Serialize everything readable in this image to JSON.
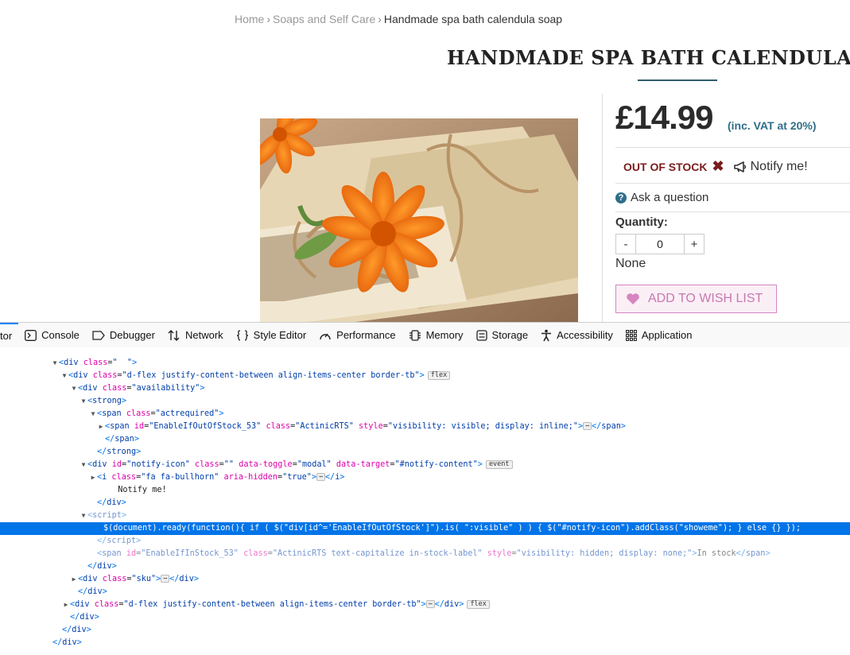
{
  "breadcrumb": {
    "home": "Home",
    "category": "Soaps and Self Care",
    "current": "Handmade spa bath calendula soap"
  },
  "product": {
    "title": "HANDMADE SPA BATH CALENDULA SOAP",
    "image_alt": "Calendula soap bars",
    "price": "£14.99",
    "vat_note": "(inc. VAT at 20%)",
    "stock_status": "OUT OF STOCK",
    "stock_mark": "✖",
    "notify_label": "Notify me!",
    "ask_label": "Ask a question",
    "quantity_label": "Quantity:",
    "quantity_minus": "-",
    "quantity_value": "0",
    "quantity_plus": "+",
    "none_text": "None",
    "wishlist_label": "ADD TO WISH LIST"
  },
  "devtools": {
    "tabs": [
      {
        "label": "tor",
        "icon": "inspector-icon"
      },
      {
        "label": "Console",
        "icon": "console-icon"
      },
      {
        "label": "Debugger",
        "icon": "debugger-icon"
      },
      {
        "label": "Network",
        "icon": "network-icon"
      },
      {
        "label": "Style Editor",
        "icon": "style-editor-icon"
      },
      {
        "label": "Performance",
        "icon": "performance-icon"
      },
      {
        "label": "Memory",
        "icon": "memory-icon"
      },
      {
        "label": "Storage",
        "icon": "storage-icon"
      },
      {
        "label": "Accessibility",
        "icon": "accessibility-icon"
      },
      {
        "label": "Application",
        "icon": "application-icon"
      }
    ],
    "lines": [
      {
        "t": "▼",
        "html": "<span class=tag>&lt;</span><span class=tagn>div</span> <span class=an>class</span>=<span class=av>\"  \"</span><span class=tag>&gt;</span>"
      },
      {
        "t": "▼",
        "html": "<span class=tag>&lt;</span><span class=tagn>div</span> <span class=an>class</span>=<span class=av>\"d-flex justify-content-between align-items-center border-tb\"</span><span class=tag>&gt;</span><span class=badge>flex</span>"
      },
      {
        "t": "▼",
        "html": "<span class=tag>&lt;</span><span class=tagn>div</span> <span class=an>class</span>=<span class=av>\"availability\"</span><span class=tag>&gt;</span>"
      },
      {
        "t": "▼",
        "html": "<span class=tag>&lt;</span><span class=tagn>strong</span><span class=tag>&gt;</span>"
      },
      {
        "t": "▼",
        "html": "<span class=tag>&lt;</span><span class=tagn>span</span> <span class=an>class</span>=<span class=av>\"actrequired\"</span><span class=tag>&gt;</span>"
      },
      {
        "t": "▶",
        "html": "<span class=tag>&lt;</span><span class=tagn>span</span> <span class=an>id</span>=<span class=av>\"EnableIfOutOfStock_53\"</span> <span class=an>class</span>=<span class=av>\"ActinicRTS\"</span> <span class=an>style</span>=<span class=av>\"visibility: visible; display: inline;\"</span><span class=tag>&gt;</span><span class=ell>⋯</span><span class=tag>&lt;/</span><span class=tagn>span</span><span class=tag>&gt;</span>"
      },
      {
        "t": "",
        "html": "<span class=tag>&lt;/</span><span class=tagn>span</span><span class=tag>&gt;</span>"
      },
      {
        "t": "",
        "html": "<span class=tag>&lt;/</span><span class=tagn>strong</span><span class=tag>&gt;</span>"
      },
      {
        "t": "▼",
        "html": "<span class=tag>&lt;</span><span class=tagn>div</span> <span class=an>id</span>=<span class=av>\"notify-icon\"</span> <span class=an>class</span>=<span class=av>\"\"</span> <span class=an>data-toggle</span>=<span class=av>\"modal\"</span> <span class=an>data-target</span>=<span class=av>\"#notify-content\"</span><span class=tag>&gt;</span><span class=badge>event</span>"
      },
      {
        "t": "▶",
        "html": "<span class=tag>&lt;</span><span class=tagn>i</span> <span class=an>class</span>=<span class=av>\"fa fa-bullhorn\"</span> <span class=an>aria-hidden</span>=<span class=av>\"true\"</span><span class=tag>&gt;</span><span class=ell>⋯</span><span class=tag>&lt;/</span><span class=tagn>i</span><span class=tag>&gt;</span>"
      },
      {
        "t": "",
        "html": "  Notify me!"
      },
      {
        "t": "",
        "html": "<span class=tag>&lt;/</span><span class=tagn>div</span><span class=tag>&gt;</span>"
      },
      {
        "t": "▼",
        "html": "<span class=dim><span class=tag>&lt;</span><span class=tagn>script</span><span class=tag>&gt;</span></span>"
      },
      {
        "t": "",
        "sel": true,
        "html": "$(document).ready(function(){ if ( $(\"div[id^='EnableIfOutOfStock']\").is( \":visible\" ) ) { $(\"#notify-icon\").addClass(\"showeme\"); } else {} });"
      },
      {
        "t": "",
        "html": "<span class=dim><span class=tag>&lt;/</span><span class=tagn>script</span><span class=tag>&gt;</span></span>"
      },
      {
        "t": "",
        "html": "<span class=dim><span class=tag>&lt;</span><span class=tagn>span</span> <span class=an>id</span>=<span class=av>\"EnableIfInStock_53\"</span> <span class=an>class</span>=<span class=av>\"ActinicRTS text-capitalize in-stock-label\"</span> <span class=an>style</span>=<span class=av>\"visibility: hidden; display: none;\"</span><span class=tag>&gt;</span>In stock<span class=tag>&lt;/</span><span class=tagn>span</span><span class=tag>&gt;</span></span>"
      },
      {
        "t": "",
        "html": "<span class=tag>&lt;/</span><span class=tagn>div</span><span class=tag>&gt;</span>"
      },
      {
        "t": "▶",
        "html": "<span class=tag>&lt;</span><span class=tagn>div</span> <span class=an>class</span>=<span class=av>\"sku\"</span><span class=tag>&gt;</span><span class=ell>⋯</span><span class=tag>&lt;/</span><span class=tagn>div</span><span class=tag>&gt;</span>"
      },
      {
        "t": "",
        "html": "<span class=tag>&lt;/</span><span class=tagn>div</span><span class=tag>&gt;</span>"
      },
      {
        "t": "▶",
        "html": "<span class=tag>&lt;</span><span class=tagn>div</span> <span class=an>class</span>=<span class=av>\"d-flex justify-content-between align-items-center border-tb\"</span><span class=tag>&gt;</span><span class=ell>⋯</span><span class=tag>&lt;/</span><span class=tagn>div</span><span class=tag>&gt;</span><span class=badge>flex</span>"
      },
      {
        "t": "",
        "html": "<span class=tag>&lt;/</span><span class=tagn>div</span><span class=tag>&gt;</span>"
      },
      {
        "t": "",
        "html": "<span class=tag>&lt;/</span><span class=tagn>div</span><span class=tag>&gt;</span>"
      },
      {
        "t": "",
        "html": "<span class=tag>&lt;/</span><span class=tagn>div</span><span class=tag>&gt;</span>"
      }
    ]
  },
  "colors": {
    "accent": "#2f6e8a",
    "out_of_stock": "#7a1d1d",
    "wishlist": "#c779b0",
    "selection": "#0074e8"
  }
}
